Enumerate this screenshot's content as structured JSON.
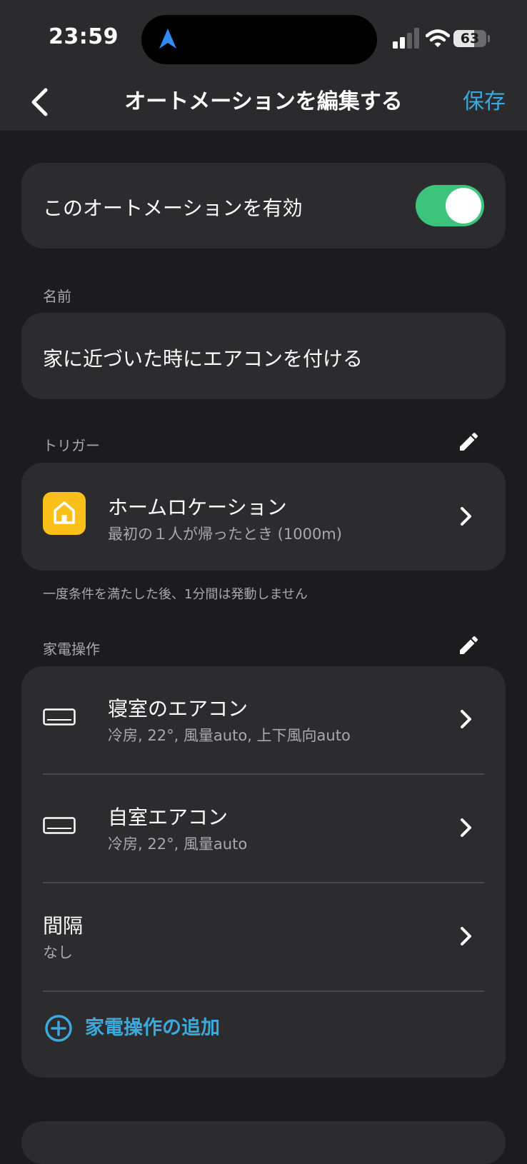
{
  "status_bar": {
    "time": "23:59",
    "battery": "63"
  },
  "nav": {
    "title": "オートメーションを編集する",
    "save_label": "保存"
  },
  "enable": {
    "label": "このオートメーションを有効",
    "enabled": true
  },
  "name_section": {
    "label": "名前",
    "value": "家に近づいた時にエアコンを付ける"
  },
  "trigger_section": {
    "label": "トリガー",
    "item": {
      "title": "ホームロケーション",
      "subtitle": "最初の１人が帰ったとき (1000m)"
    },
    "note": "一度条件を満たした後、1分間は発動しません"
  },
  "actions_section": {
    "label": "家電操作",
    "items": [
      {
        "title": "寝室のエアコン",
        "subtitle": "冷房, 22°, 風量auto, 上下風向auto"
      },
      {
        "title": "自室エアコン",
        "subtitle": "冷房, 22°, 風量auto"
      },
      {
        "title": "間隔",
        "subtitle": "なし"
      }
    ],
    "add_label": "家電操作の追加"
  },
  "colors": {
    "background": "#1c1c1e",
    "card": "#2c2c2e",
    "accent": "#3aa9de",
    "toggle_on": "#3cc47c",
    "home_icon": "#fbbf1a"
  }
}
